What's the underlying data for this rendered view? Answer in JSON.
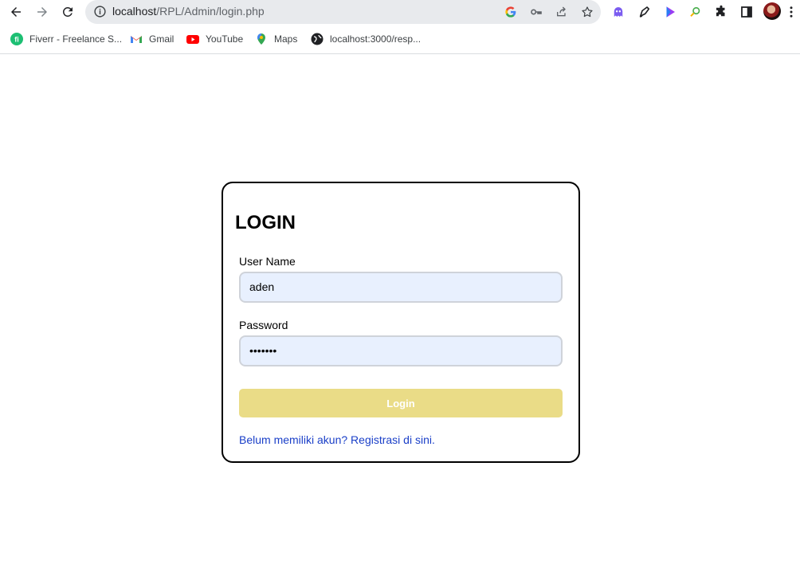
{
  "browser": {
    "url_host": "localhost",
    "url_path": "/RPL/Admin/login.php",
    "bookmarks": [
      {
        "label": "Fiverr - Freelance S...",
        "icon": "fiverr-icon"
      },
      {
        "label": "Gmail",
        "icon": "gmail-icon"
      },
      {
        "label": "YouTube",
        "icon": "youtube-icon"
      },
      {
        "label": "Maps",
        "icon": "maps-icon"
      },
      {
        "label": "localhost:3000/resp...",
        "icon": "globe-icon"
      }
    ],
    "colors": {
      "omnibox_bg": "#e8eaed",
      "divider": "#dadce0"
    }
  },
  "login": {
    "title": "LOGIN",
    "username_label": "User Name",
    "username_value": "aden",
    "password_label": "Password",
    "password_value": "•••••••",
    "button_label": "Login",
    "register_link": "Belum memiliki akun? Registrasi di sini.",
    "colors": {
      "button": "#eadc87",
      "input_bg": "#e8f0fe",
      "link": "#1a3fc8"
    }
  }
}
